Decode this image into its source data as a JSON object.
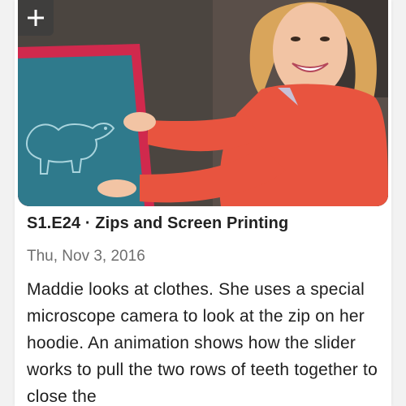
{
  "episode": {
    "code": "S1.E24",
    "separator": " · ",
    "name": "Zips and Screen Printing",
    "date": "Thu, Nov 3, 2016",
    "description": "Maddie looks at clothes. She uses a special microscope camera to look at the zip on her hoodie. An animation shows how the slider works to pull the two rows of teeth together to close the"
  },
  "thumbnail": {
    "add_icon": "plus-icon",
    "screen_color": "#2f7a8c",
    "frame_color": "#d0294d",
    "hoodie_color": "#e8543f"
  }
}
